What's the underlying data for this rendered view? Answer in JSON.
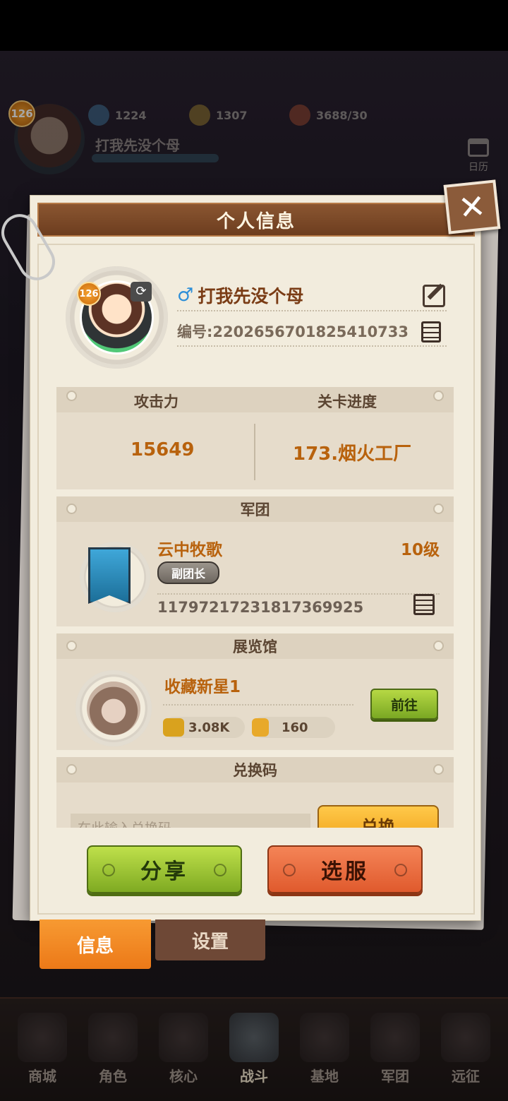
{
  "background": {
    "player_level": "126",
    "resources": [
      {
        "icon": "diamond-icon",
        "value": "1224"
      },
      {
        "icon": "coin-icon",
        "value": "1307"
      },
      {
        "icon": "meat-icon",
        "value": "3688/30"
      }
    ],
    "player_name": "打我先没个母",
    "calendar_label": "日历",
    "bottom_nav": [
      "商城",
      "角色",
      "核心",
      "战斗",
      "基地",
      "军团",
      "远征"
    ]
  },
  "modal": {
    "title": "个人信息",
    "close_icon": "close-icon",
    "profile": {
      "level": "126",
      "gender_symbol": "♂",
      "name": "打我先没个母",
      "id_text": "编号:2202656701825410733"
    },
    "stats": {
      "attack_label": "攻击力",
      "progress_label": "关卡进度",
      "attack_value": "15649",
      "progress_value": "173.烟火工厂"
    },
    "guild": {
      "header": "军团",
      "name": "云中牧歌",
      "level": "10级",
      "role": "副团长",
      "id": "11797217231817369925"
    },
    "museum": {
      "header": "展览馆",
      "title": "收藏新星1",
      "score": "3.08K",
      "likes": "160",
      "go_label": "前往"
    },
    "redeem": {
      "header": "兑换码",
      "placeholder": "在此输入兑换码",
      "button": "兑换"
    },
    "buttons": {
      "share": "分享",
      "select_server": "选服"
    },
    "tabs": {
      "info": "信息",
      "settings": "设置"
    }
  },
  "colors": {
    "accent_orange": "#b8620d",
    "title_brown": "#7a4525",
    "green_button": "#9cc53a",
    "red_button": "#e86a3c"
  }
}
